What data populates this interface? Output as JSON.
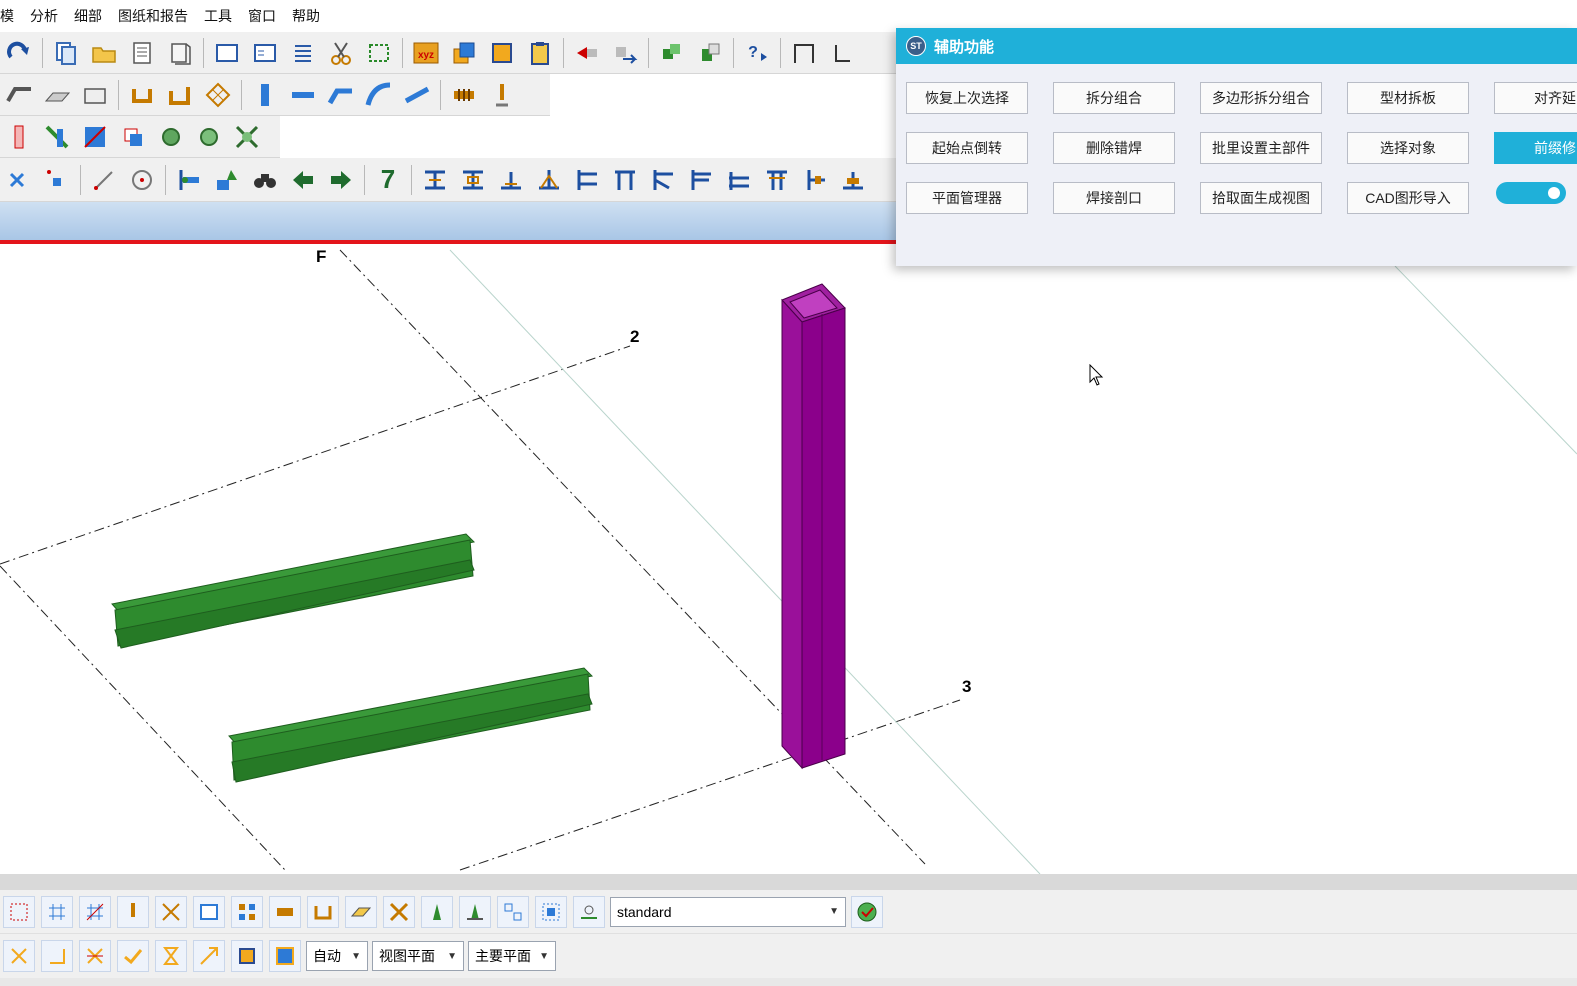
{
  "menu": [
    "模",
    "分析",
    "细部",
    "图纸和报告",
    "工具",
    "窗口",
    "帮助"
  ],
  "toolbar4": {
    "number_label": "7"
  },
  "viewport": {
    "grid_labels": {
      "f": "F",
      "two": "2",
      "three": "3"
    }
  },
  "assist_panel": {
    "title": "辅助功能",
    "logo": "ST",
    "buttons": [
      {
        "label": "恢复上次选择",
        "active": false
      },
      {
        "label": "拆分组合",
        "active": false
      },
      {
        "label": "多边形拆分组合",
        "active": false
      },
      {
        "label": "型材拆板",
        "active": false
      },
      {
        "label": "对齐延",
        "active": false
      },
      {
        "label": "起始点倒转",
        "active": false
      },
      {
        "label": "删除错焊",
        "active": false
      },
      {
        "label": "批里设置主部件",
        "active": false
      },
      {
        "label": "选择对象",
        "active": false
      },
      {
        "label": "前缀修",
        "active": true
      },
      {
        "label": "平面管理器",
        "active": false
      },
      {
        "label": "焊接剖口",
        "active": false
      },
      {
        "label": "拾取面生成视图",
        "active": false
      },
      {
        "label": "CAD图形导入",
        "active": false
      }
    ],
    "toggle_on": true
  },
  "bottom": {
    "standard_select": "standard",
    "snap_mode_select": "自动",
    "plane_select": "视图平面",
    "main_plane_select": "主要平面"
  },
  "colors": {
    "accent": "#1fb0d9",
    "beam": "#2e8b2e",
    "column": "#8b008b",
    "view_underline": "#e3151b"
  }
}
